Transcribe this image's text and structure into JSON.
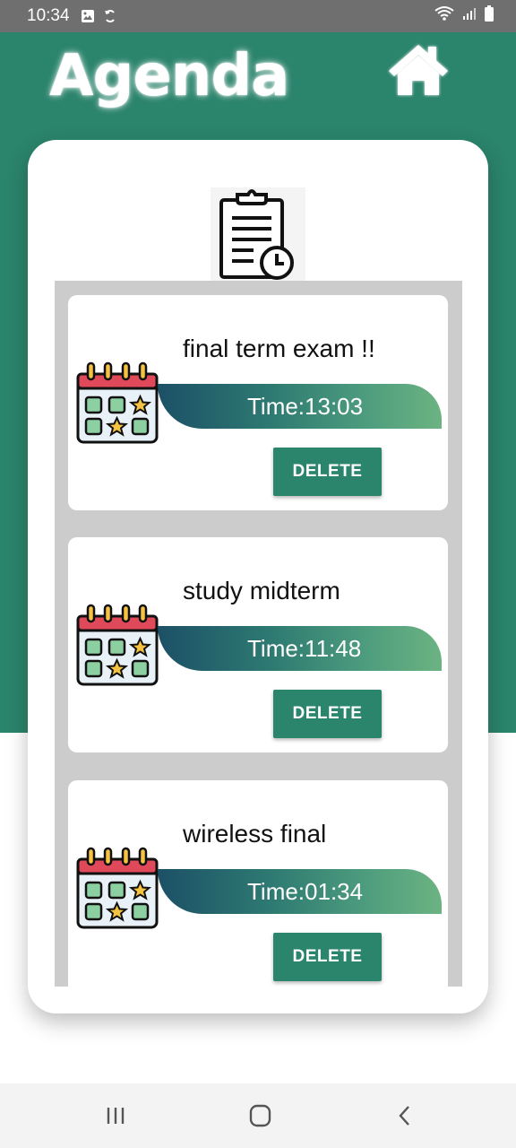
{
  "status_bar": {
    "time": "10:34",
    "icons": [
      "image-icon",
      "sync-icon",
      "wifi-icon",
      "signal-icon",
      "battery-icon"
    ]
  },
  "header": {
    "title": "Agenda",
    "home_icon": "home-icon"
  },
  "colors": {
    "primary": "#2b846c",
    "list_background": "#cccccc",
    "card": "#ffffff",
    "calendar_red": "#e0495a",
    "calendar_green": "#8ccfa0",
    "star": "#f5c242"
  },
  "agenda_items": [
    {
      "title": "final term exam !!",
      "time": "Time:13:03",
      "delete_label": "DELETE"
    },
    {
      "title": "study midterm",
      "time": "Time:11:48",
      "delete_label": "DELETE"
    },
    {
      "title": "wireless final",
      "time": "Time:01:34",
      "delete_label": "DELETE"
    }
  ],
  "nav_bar": {
    "buttons": [
      "recent-apps-icon",
      "home-nav-icon",
      "back-icon"
    ]
  }
}
